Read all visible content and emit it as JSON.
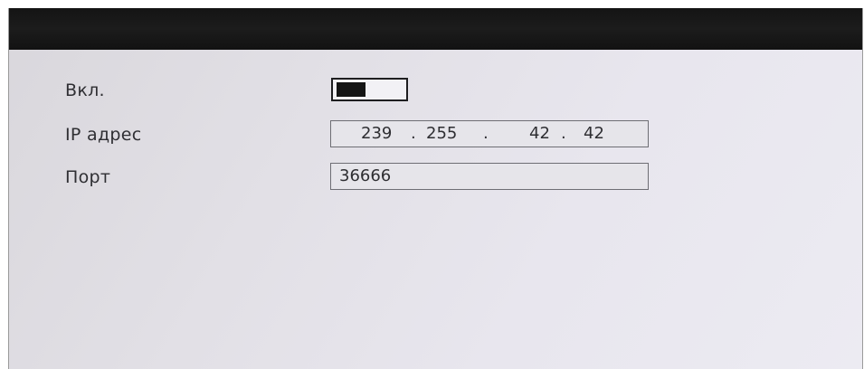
{
  "settings": {
    "enable": {
      "label": "Вкл.",
      "state": true
    },
    "ip": {
      "label": "IP адрес",
      "octets": [
        "239",
        "255",
        "42",
        "42"
      ],
      "separator": "."
    },
    "port": {
      "label": "Порт",
      "value": "36666"
    }
  },
  "colors": {
    "titlebar": "#161616",
    "background": "#e4e2e8",
    "text": "#2f2f33",
    "toggle_on": "#151515"
  }
}
